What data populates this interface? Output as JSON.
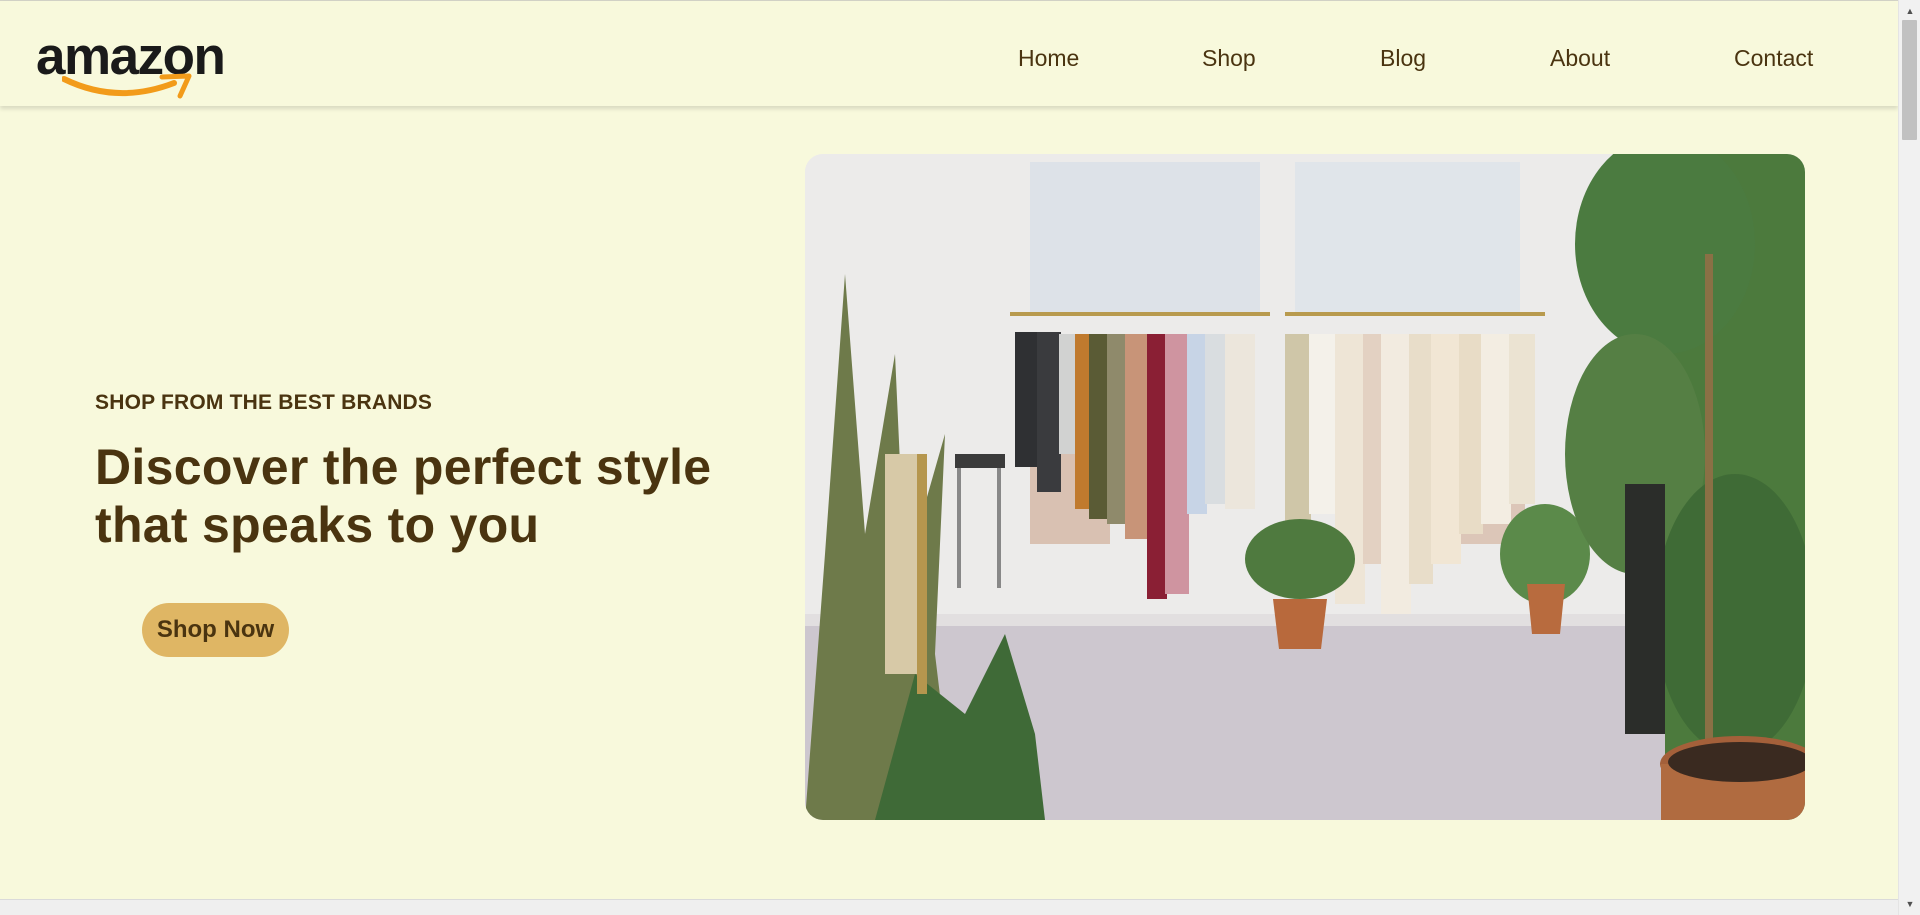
{
  "brand": {
    "logo_text": "amazon",
    "logo_color": "#1a1a1a",
    "smile_color": "#f29b1a"
  },
  "nav": {
    "items": [
      {
        "label": "Home"
      },
      {
        "label": "Shop"
      },
      {
        "label": "Blog"
      },
      {
        "label": "About"
      },
      {
        "label": "Contact"
      }
    ]
  },
  "hero": {
    "subheading": "SHOP FROM THE BEST BRANDS",
    "title_line1": "Discover the perfect style",
    "title_line2": "that speaks to you",
    "cta_label": "Shop Now",
    "image_icon": "clothing-store-photo"
  },
  "theme": {
    "background": "#f8f9dc",
    "text": "#4a3410",
    "accent": "#dfb664"
  },
  "scrollbar": {
    "up_icon": "triangle-up-icon",
    "down_icon": "triangle-down-icon"
  }
}
